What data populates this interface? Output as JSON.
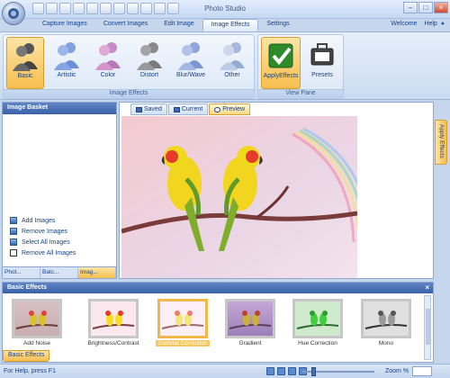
{
  "app": {
    "title": "Photo Studio"
  },
  "help": {
    "welcome": "Welcome",
    "help": "Help"
  },
  "tabs": [
    "Capture Images",
    "Convert Images",
    "Edit Image",
    "Image Effects",
    "Settings"
  ],
  "ribbon": {
    "effects_group": {
      "label": "Image Effects",
      "buttons": [
        "Basic",
        "Artistic",
        "Color",
        "Distort",
        "Blur/Wave",
        "Other"
      ]
    },
    "view_group": {
      "label": "View Pane",
      "buttons": [
        "ApplyEffects",
        "Presets"
      ]
    }
  },
  "basket": {
    "title": "Image Basket",
    "actions": [
      "Add Images",
      "Remove Images",
      "Select All Images",
      "Remove All Images"
    ],
    "tabs": [
      "Phot...",
      "Batc...",
      "Imag..."
    ]
  },
  "viewer": {
    "tabs": [
      "Saved",
      "Current",
      "Preview"
    ],
    "side_tab": "Apply Effects"
  },
  "effects": {
    "title": "Basic Effects",
    "items": [
      "Add Noise",
      "Brightness/Contrast",
      "Gamma Correction",
      "Gradient",
      "Hue Correction",
      "Mono"
    ],
    "bottom_tab": "Basic Effects"
  },
  "status": {
    "text": "For Help, press F1",
    "zoom_label": "Zoom %"
  },
  "colors": {
    "accent": "#f6be4e",
    "header": "#3a62a8"
  }
}
